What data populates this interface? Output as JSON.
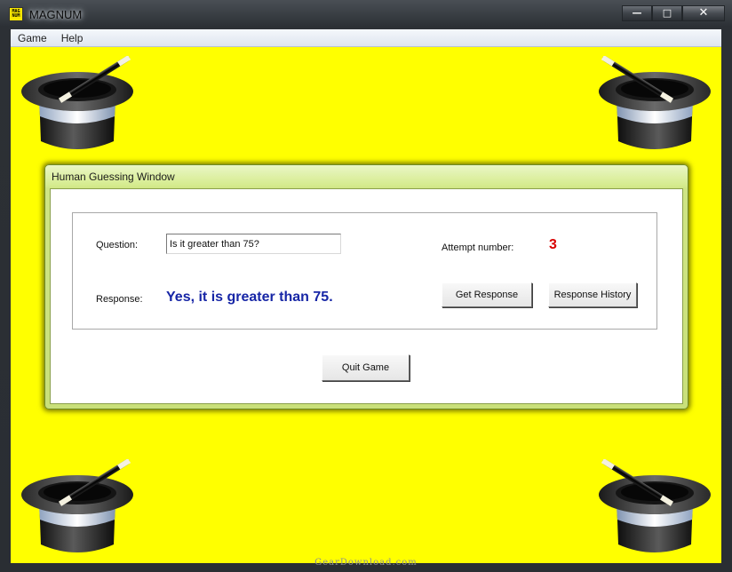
{
  "window": {
    "title": "MAGNUM",
    "icon_text": "MAG NUM",
    "controls": {
      "minimize": "—",
      "maximize": "□",
      "close": "✕"
    }
  },
  "menu": [
    {
      "label": "Game"
    },
    {
      "label": "Help"
    }
  ],
  "colors": {
    "background": "#ffff00",
    "response_text": "#1726a6",
    "attempt_text": "#d90000"
  },
  "dialog": {
    "title": "Human Guessing Window",
    "question_label": "Question:",
    "question_value": "Is it greater than 75?",
    "response_label": "Response:",
    "response_value": "Yes, it is greater than 75.",
    "attempt_label": "Attempt number:",
    "attempt_value": "3",
    "get_response_button": "Get Response",
    "response_history_button": "Response History",
    "quit_button": "Quit Game"
  },
  "decorations": {
    "corner_icon": "magic-hat-with-wand-icon"
  },
  "footer": {
    "watermark": "GearDownload.com"
  }
}
